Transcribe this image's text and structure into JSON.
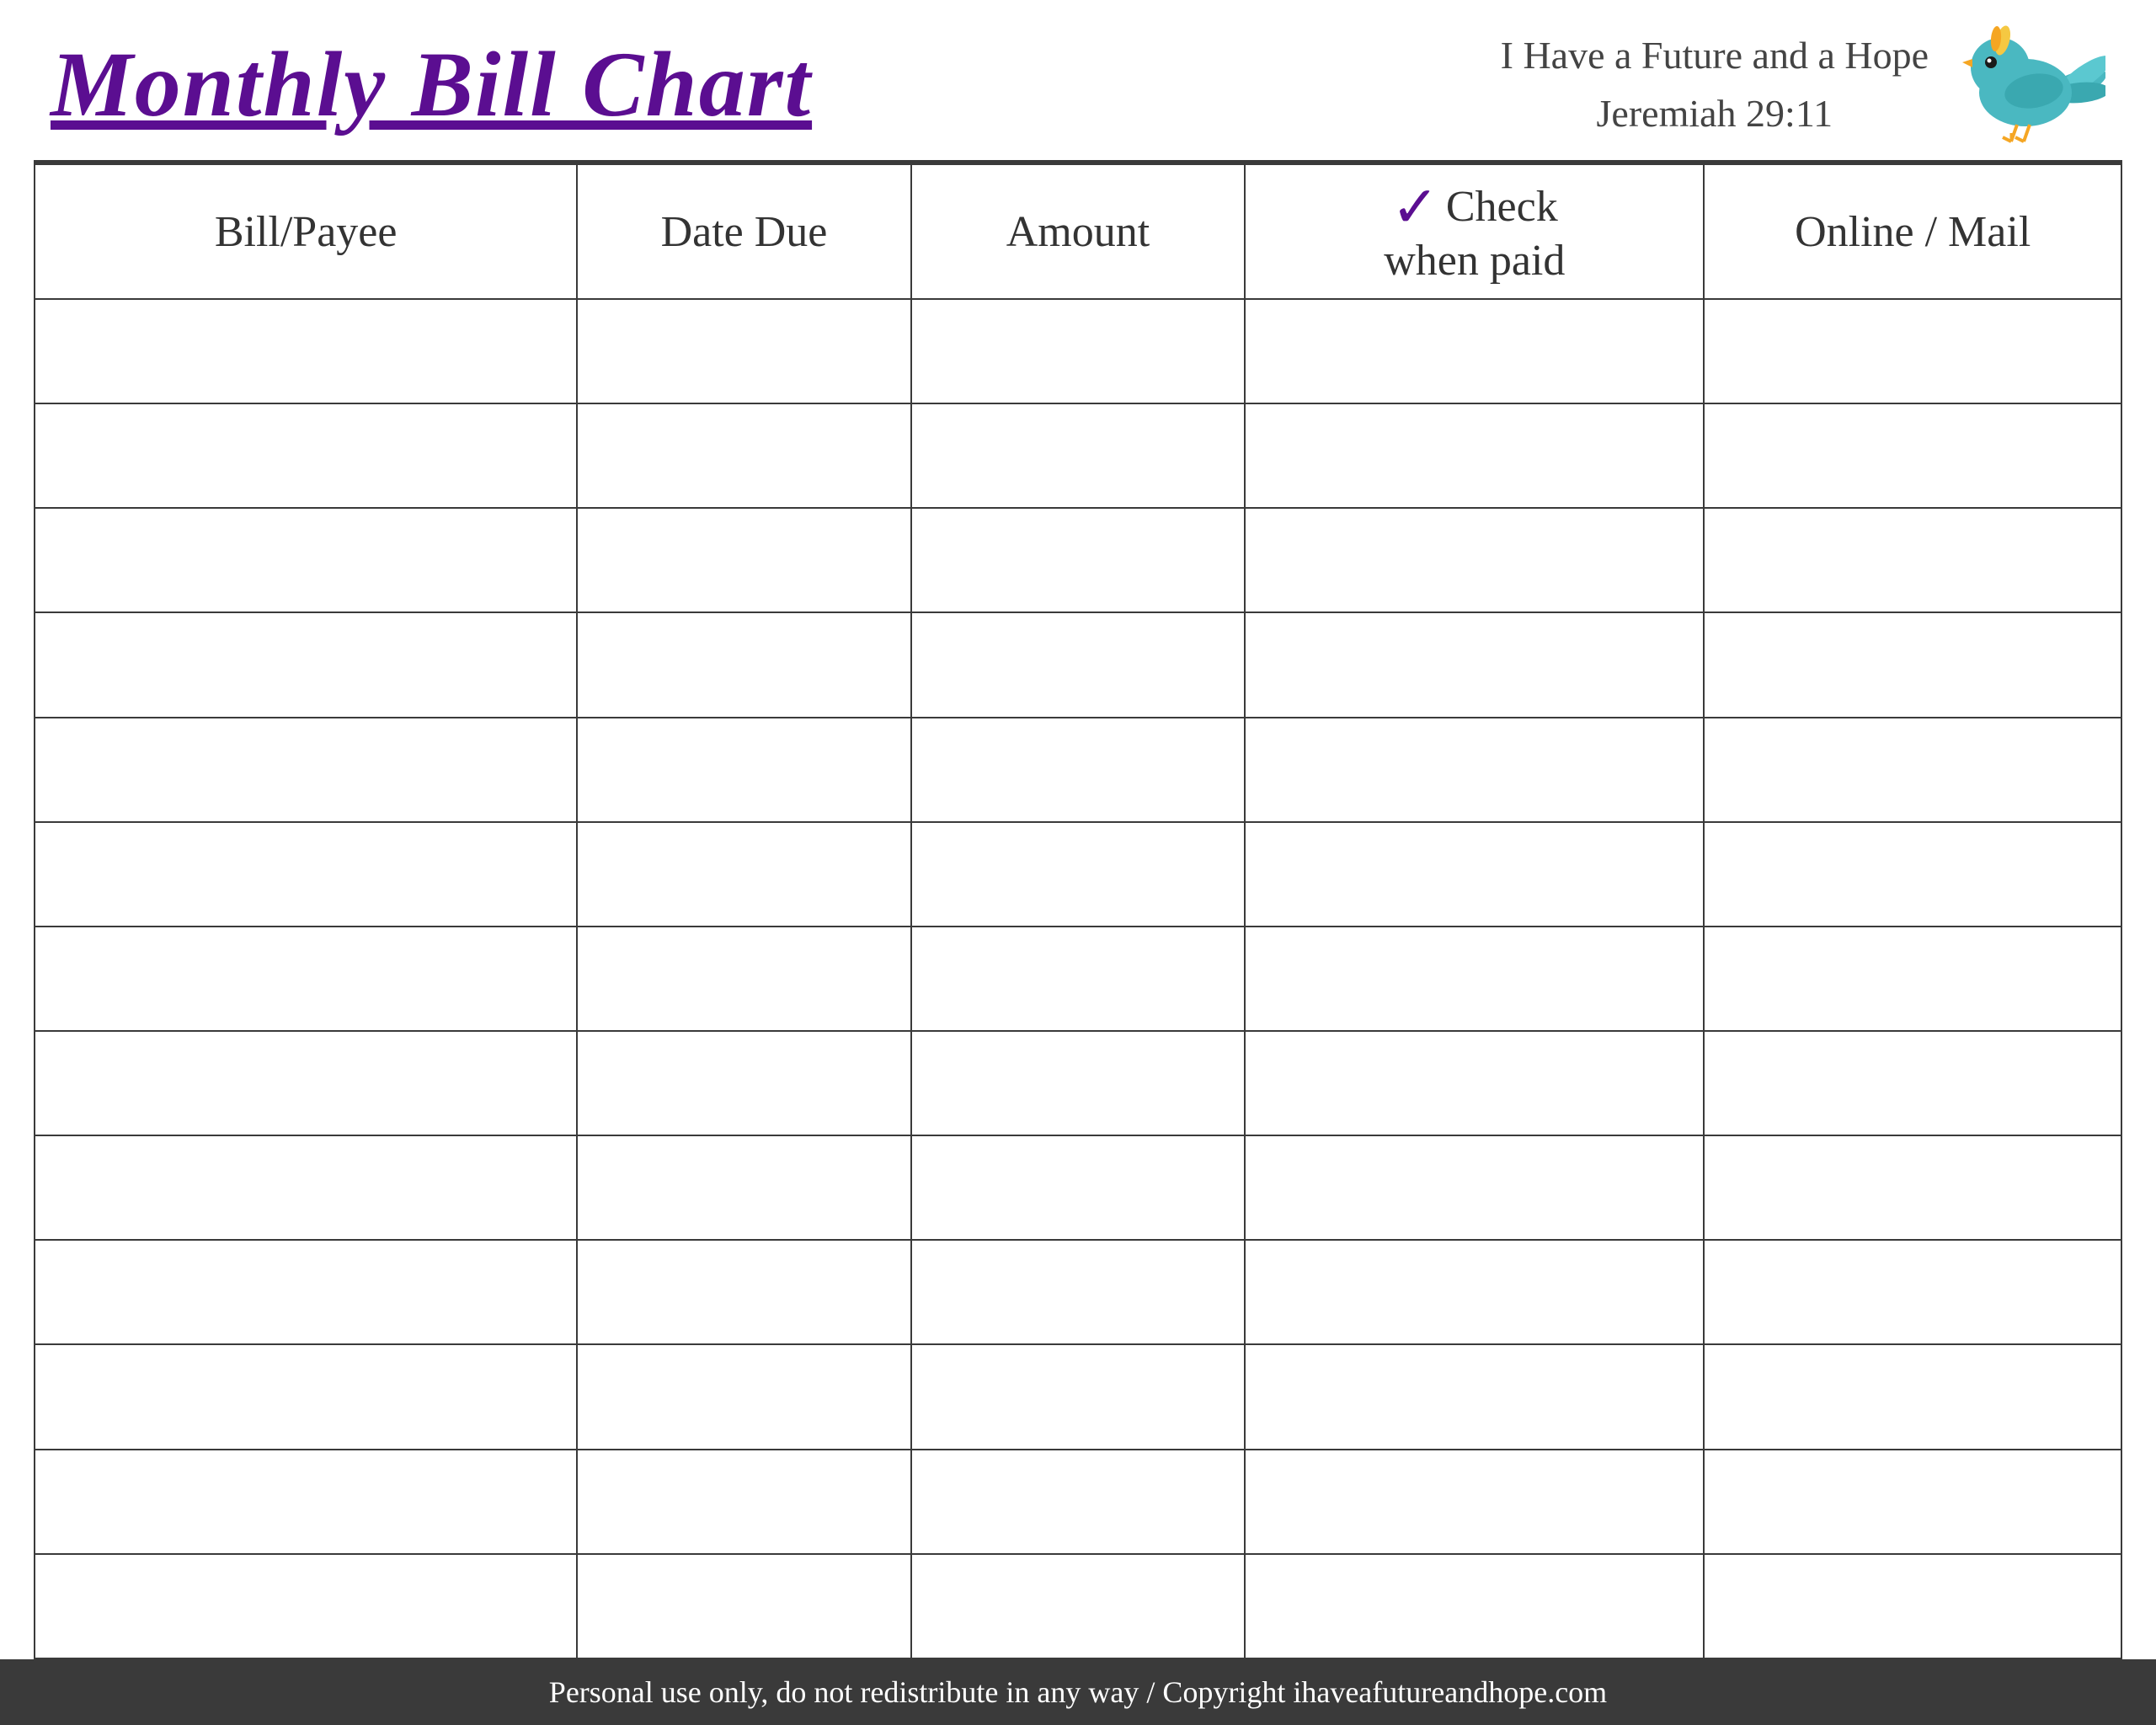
{
  "header": {
    "title": "Monthly Bill Chart",
    "verse_line1": "I Have a Future and a Hope",
    "verse_line2": "Jeremiah 29:11"
  },
  "table": {
    "columns": [
      {
        "id": "bill",
        "label": "Bill/Payee"
      },
      {
        "id": "date",
        "label": "Date Due"
      },
      {
        "id": "amount",
        "label": "Amount"
      },
      {
        "id": "check",
        "label_line1": "Check",
        "label_line2": "when paid",
        "checkmark": "✓"
      },
      {
        "id": "online",
        "label": "Online / Mail"
      }
    ],
    "row_count": 13
  },
  "footer": {
    "text": "Personal use only, do not redistribute in any way / Copyright ihaveafutureandhope.com"
  }
}
